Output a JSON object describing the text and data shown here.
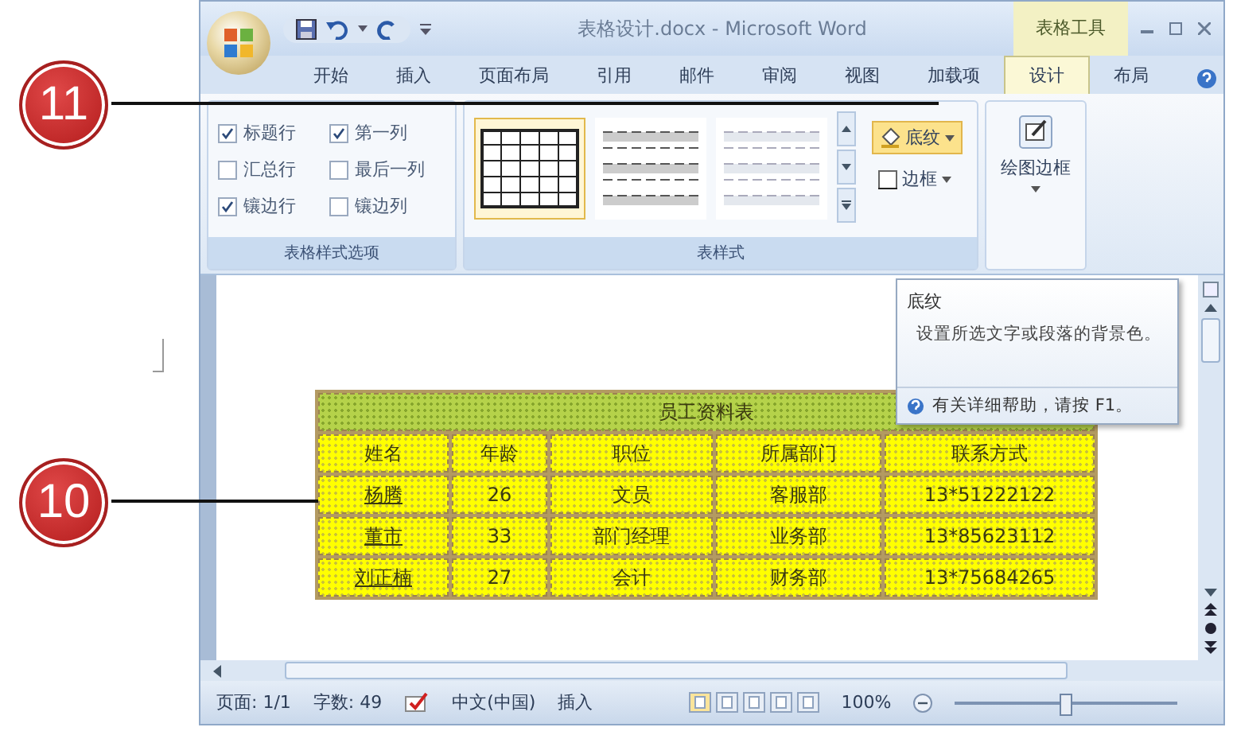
{
  "window": {
    "title": "表格设计.docx - Microsoft Word",
    "context_tab": "表格工具"
  },
  "tabs": [
    {
      "label": "开始",
      "selected": false
    },
    {
      "label": "插入",
      "selected": false
    },
    {
      "label": "页面布局",
      "selected": false
    },
    {
      "label": "引用",
      "selected": false
    },
    {
      "label": "邮件",
      "selected": false
    },
    {
      "label": "审阅",
      "selected": false
    },
    {
      "label": "视图",
      "selected": false
    },
    {
      "label": "加载项",
      "selected": false
    },
    {
      "label": "设计",
      "selected": true
    },
    {
      "label": "布局",
      "selected": false
    }
  ],
  "ribbon": {
    "style_options": {
      "label": "表格样式选项",
      "options": [
        {
          "label": "标题行",
          "checked": true
        },
        {
          "label": "第一列",
          "checked": true
        },
        {
          "label": "汇总行",
          "checked": false
        },
        {
          "label": "最后一列",
          "checked": false
        },
        {
          "label": "镶边行",
          "checked": true
        },
        {
          "label": "镶边列",
          "checked": false
        }
      ]
    },
    "table_styles": {
      "label": "表样式",
      "styles": [
        {
          "selected": true
        },
        {
          "selected": false
        },
        {
          "selected": false
        }
      ]
    },
    "shading_button": "底纹",
    "border_button": "边框",
    "draw_borders_button": "绘图边框"
  },
  "tooltip": {
    "title": "底纹",
    "description": "设置所选文字或段落的背景色。",
    "help": "有关详细帮助，请按 F1。"
  },
  "document_table": {
    "title": "员工资料表",
    "columns": [
      "姓名",
      "年龄",
      "职位",
      "所属部门",
      "联系方式"
    ],
    "rows": [
      [
        "杨腾",
        "26",
        "文员",
        "客服部",
        "13*51222122"
      ],
      [
        "董市",
        "33",
        "部门经理",
        "业务部",
        "13*85623112"
      ],
      [
        "刘正楠",
        "27",
        "会计",
        "财务部",
        "13*75684265"
      ]
    ]
  },
  "status_bar": {
    "page": "页面: 1/1",
    "words": "字数: 49",
    "language": "中文(中国)",
    "mode": "插入",
    "zoom": "100%"
  },
  "callouts": [
    {
      "number": "11"
    },
    {
      "number": "10"
    }
  ]
}
